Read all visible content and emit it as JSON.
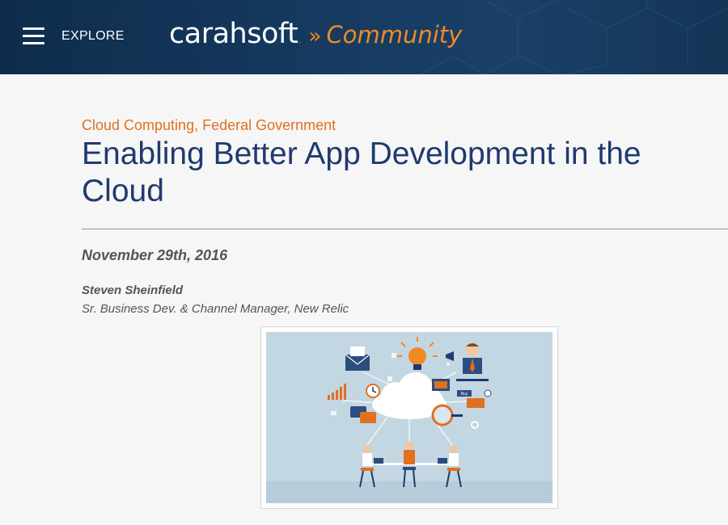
{
  "header": {
    "menu_label": "EXPLORE",
    "logo_name": "carahsoft",
    "logo_tm": ".",
    "logo_arrows": "»",
    "logo_community": "Community"
  },
  "article": {
    "categories": [
      "Cloud Computing",
      "Federal Government"
    ],
    "category_separator": ",",
    "title": "Enabling Better App Development in the Cloud",
    "date": "November 29th, 2016",
    "author_name": "Steven Sheinfield",
    "author_title": "Sr. Business Dev. & Channel Manager, New Relic"
  },
  "figure": {
    "cloud_chart_bar_label": "",
    "tag_label": "Buy"
  },
  "colors": {
    "header_bg": "#163a60",
    "accent_orange": "#e2701f",
    "title_blue": "#1f3a6e",
    "figure_bg": "#c3d7e2"
  }
}
